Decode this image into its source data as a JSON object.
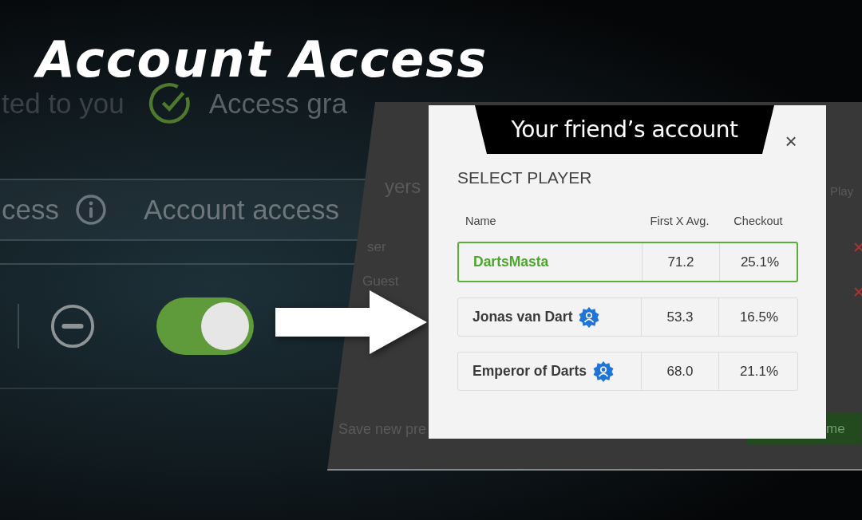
{
  "title": "Account Access",
  "status": {
    "shared_label": "ted to you",
    "granted_label": "Access gra"
  },
  "header": {
    "left_label": "cess",
    "right_label": "Account access"
  },
  "access_row": {
    "toggle_on": true
  },
  "back_screen": {
    "heading": "yers",
    "rows": [
      "ser",
      "Guest"
    ],
    "footer_link": "Save new pre",
    "column_label": "Play",
    "button_label": "me"
  },
  "dialog": {
    "title": "Your friend’s account",
    "close": "×",
    "subtitle": "SELECT PLAYER",
    "columns": [
      "Name",
      "First X Avg.",
      "Checkout"
    ],
    "rows": [
      {
        "name": "DartsMasta",
        "avg": "71.2",
        "checkout": "25.1%",
        "selected": true,
        "verified": false
      },
      {
        "name": "Jonas van Dart",
        "avg": "53.3",
        "checkout": "16.5%",
        "selected": false,
        "verified": true
      },
      {
        "name": "Emperor of Darts",
        "avg": "68.0",
        "checkout": "21.1%",
        "selected": false,
        "verified": true
      }
    ]
  }
}
